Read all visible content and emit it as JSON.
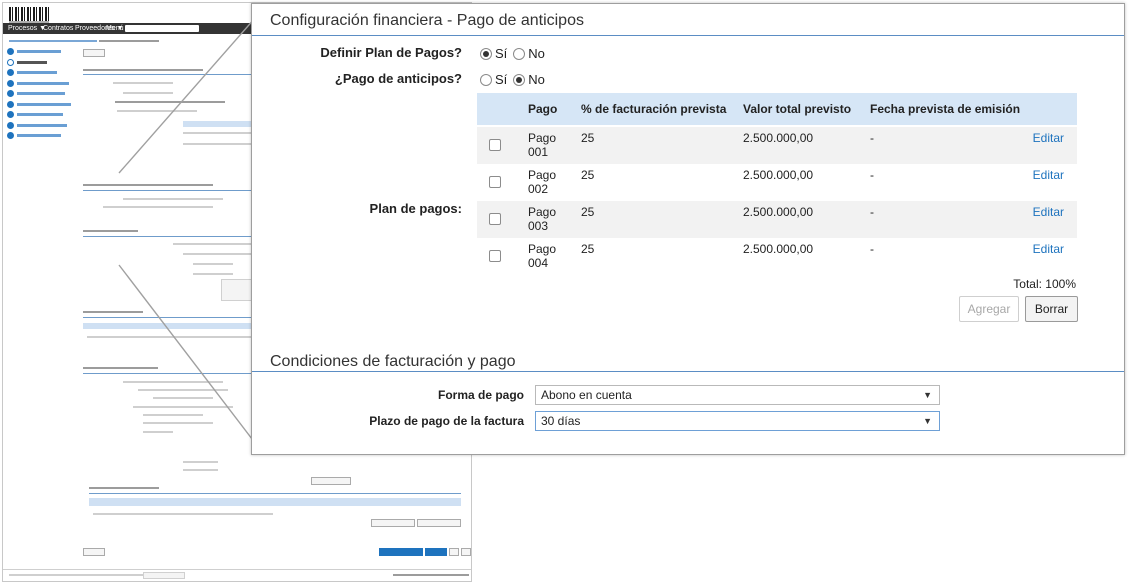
{
  "background_page": {
    "nav_items": [
      "Procesos ▼",
      "Contratos",
      "Proveedores ▼",
      "Menú ▼"
    ]
  },
  "zoom": {
    "section1_title": "Configuración financiera - Pago de anticipos",
    "definir_plan": {
      "label": "Definir Plan de Pagos?",
      "options": [
        "Sí",
        "No"
      ],
      "selected": "Sí"
    },
    "pago_anticipos": {
      "label": "¿Pago de anticipos?",
      "options": [
        "Sí",
        "No"
      ],
      "selected": "No"
    },
    "plan_label": "Plan de pagos:",
    "table": {
      "headers": [
        "Pago",
        "% de facturación prevista",
        "Valor total previsto",
        "Fecha prevista de emisión"
      ],
      "rows": [
        {
          "pago": "Pago 001",
          "pago_l1": "Pago",
          "pago_l2": "001",
          "porcentaje": "25",
          "valor": "2.500.000,00",
          "fecha": "-",
          "accion": "Editar"
        },
        {
          "pago": "Pago 002",
          "pago_l1": "Pago",
          "pago_l2": "002",
          "porcentaje": "25",
          "valor": "2.500.000,00",
          "fecha": "-",
          "accion": "Editar"
        },
        {
          "pago": "Pago 003",
          "pago_l1": "Pago",
          "pago_l2": "003",
          "porcentaje": "25",
          "valor": "2.500.000,00",
          "fecha": "-",
          "accion": "Editar"
        },
        {
          "pago": "Pago 004",
          "pago_l1": "Pago",
          "pago_l2": "004",
          "porcentaje": "25",
          "valor": "2.500.000,00",
          "fecha": "-",
          "accion": "Editar"
        }
      ]
    },
    "total": "Total: 100%",
    "buttons": {
      "agregar": "Agregar",
      "borrar": "Borrar"
    },
    "section2_title": "Condiciones de facturación y pago",
    "forma_pago": {
      "label": "Forma de pago",
      "value": "Abono en cuenta"
    },
    "plazo_pago": {
      "label": "Plazo de pago de la factura",
      "value": "30 días"
    }
  },
  "colors": {
    "accent": "#1e73be",
    "table_header": "#d6e6f6",
    "section_rule": "#5b8dc4"
  },
  "icons": {
    "select_caret": "chevron-down-icon"
  }
}
